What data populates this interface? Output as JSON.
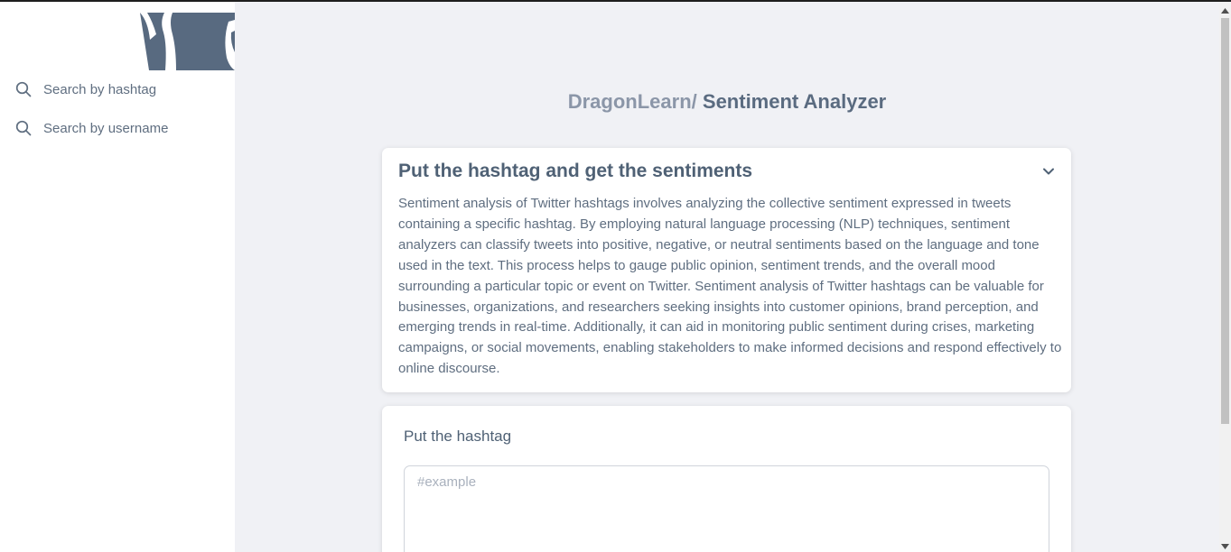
{
  "sidebar": {
    "logo_icon": "dragon-logo-icon",
    "items": [
      {
        "icon": "search-icon",
        "label": "Search by hashtag"
      },
      {
        "icon": "search-icon",
        "label": "Search by username"
      }
    ]
  },
  "header": {
    "crumb": "DragonLearn/",
    "title": "Sentiment Analyzer"
  },
  "info_card": {
    "title": "Put the hashtag and get the sentiments",
    "toggle_icon": "chevron-down-icon",
    "description": "Sentiment analysis of Twitter hashtags involves analyzing the collective sentiment expressed in tweets containing a specific hashtag. By employing natural language processing (NLP) techniques, sentiment analyzers can classify tweets into positive, negative, or neutral sentiments based on the language and tone used in the text. This process helps to gauge public opinion, sentiment trends, and the overall mood surrounding a particular topic or event on Twitter. Sentiment analysis of Twitter hashtags can be valuable for businesses, organizations, and researchers seeking insights into customer opinions, brand perception, and emerging trends in real-time. Additionally, it can aid in monitoring public sentiment during crises, marketing campaigns, or social movements, enabling stakeholders to make informed decisions and respond effectively to online discourse."
  },
  "form_card": {
    "label": "Put the hashtag",
    "input_value": "",
    "input_placeholder": "#example"
  },
  "colors": {
    "accent": "#5a6b80",
    "background": "#f0f1f5",
    "logo": "#586a80"
  }
}
